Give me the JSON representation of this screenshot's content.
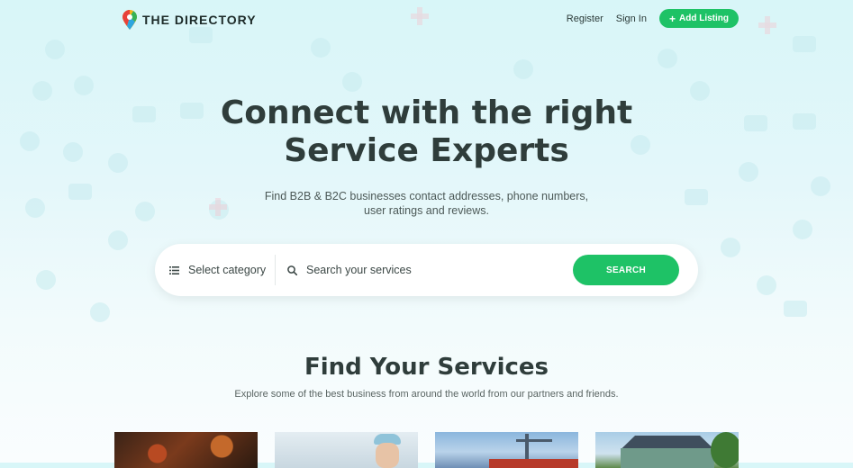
{
  "header": {
    "brand": "THE DIRECTORY",
    "nav": {
      "register": "Register",
      "sign_in": "Sign In",
      "add_listing": "Add Listing"
    }
  },
  "hero": {
    "title_line1": "Connect with the right",
    "title_line2": "Service Experts",
    "subtitle_line1": "Find B2B & B2C businesses contact addresses, phone numbers,",
    "subtitle_line2": "user ratings and reviews."
  },
  "search": {
    "category_label": "Select category",
    "placeholder": "Search your services",
    "button_label": "SEARCH"
  },
  "services": {
    "title": "Find Your Services",
    "subtitle": "Explore some of the best business from around the world from our partners and friends."
  },
  "colors": {
    "accent": "#1ec266",
    "text_dark": "#2f3d3b",
    "background_tint": "#dcf6f8"
  },
  "icons": [
    "map-pin-logo-icon",
    "plus-icon",
    "list-icon",
    "search-icon"
  ]
}
